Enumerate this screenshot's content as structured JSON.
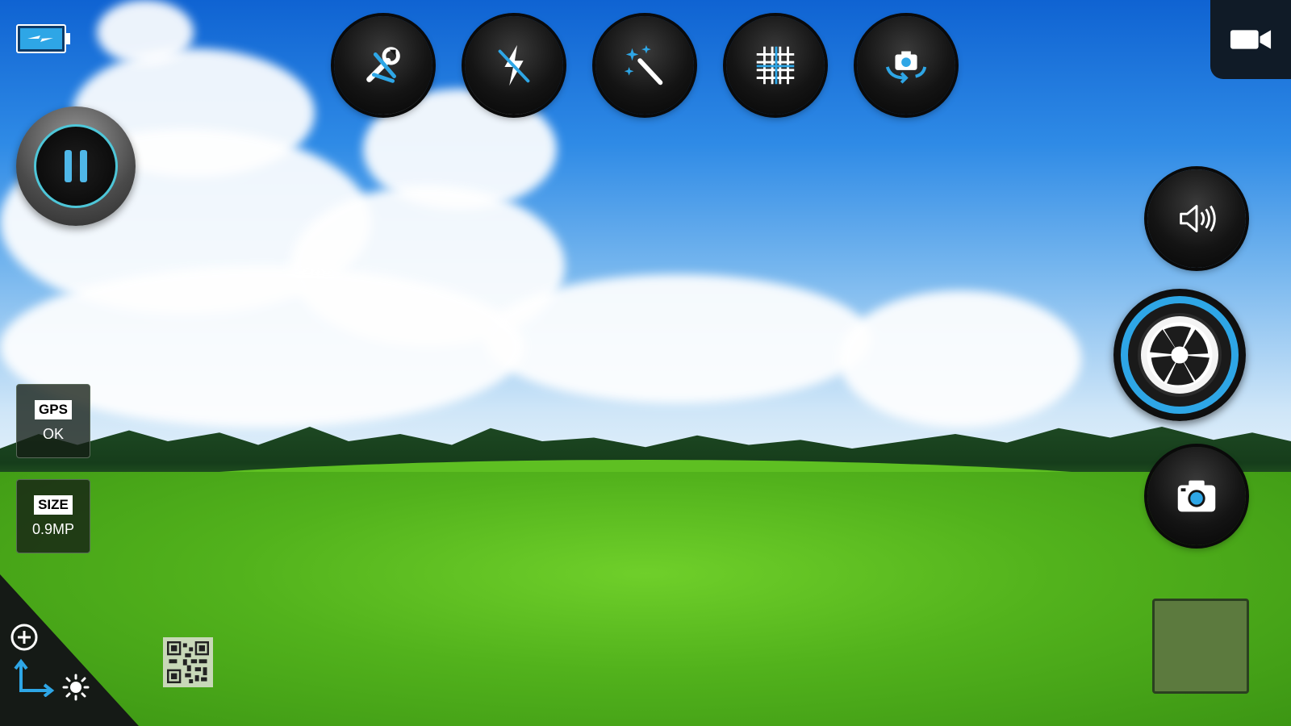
{
  "toolbar": {
    "items": [
      {
        "name": "settings",
        "icon": "tools-icon"
      },
      {
        "name": "flash",
        "icon": "flash-off-icon"
      },
      {
        "name": "effects",
        "icon": "magic-wand-icon"
      },
      {
        "name": "grid",
        "icon": "grid-icon"
      },
      {
        "name": "switch-camera",
        "icon": "switch-camera-icon"
      }
    ]
  },
  "status": {
    "battery_icon": "battery-charging-icon",
    "gps_label": "GPS",
    "gps_value": "OK",
    "size_label": "SIZE",
    "size_value": "0.9MP"
  },
  "controls": {
    "pause_icon": "pause-icon",
    "video_icon": "video-camera-icon",
    "sound_icon": "speaker-icon",
    "shutter_icon": "aperture-icon",
    "photo_icon": "camera-icon",
    "zoom_icon": "zoom-in-icon",
    "orientation_icon": "orientation-icon",
    "brightness_icon": "brightness-icon",
    "qr_icon": "qr-code-icon"
  },
  "colors": {
    "accent": "#2ea6e6",
    "button_bg": "#0a0a0a"
  }
}
